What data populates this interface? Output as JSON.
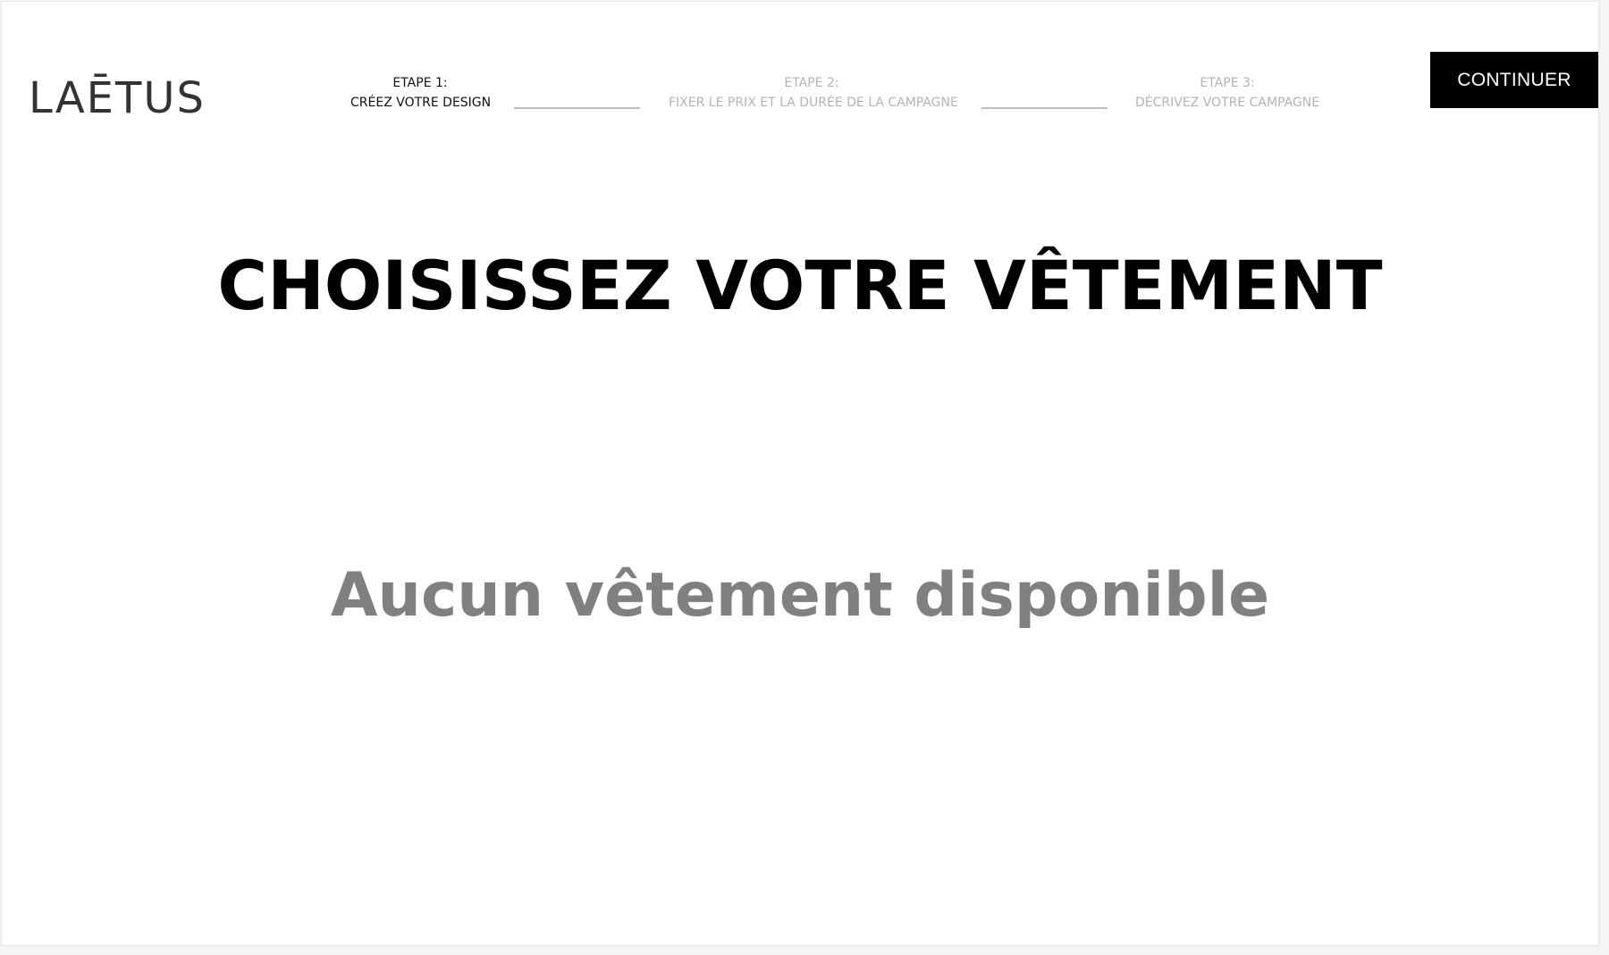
{
  "header": {
    "logo_text": "LAĒTUS",
    "continue_label": "CONTINUER"
  },
  "steps": [
    {
      "title": "ETAPE 1:",
      "desc": "CRÉEZ VOTRE DESIGN",
      "active": true
    },
    {
      "title": "ETAPE 2:",
      "desc": "FIXER LE PRIX ET LA DURÉE DE LA CAMPAGNE",
      "active": false
    },
    {
      "title": "ETAPE 3:",
      "desc": "DÉCRIVEZ VOTRE CAMPAGNE",
      "active": false
    }
  ],
  "main": {
    "title": "CHOISISSEZ VOTRE VÊTEMENT",
    "empty_message": "Aucun vêtement disponible"
  },
  "colors": {
    "active_step": "#111111",
    "inactive_step": "#b3b3b3",
    "button_bg": "#000000",
    "empty_message": "#808080"
  }
}
